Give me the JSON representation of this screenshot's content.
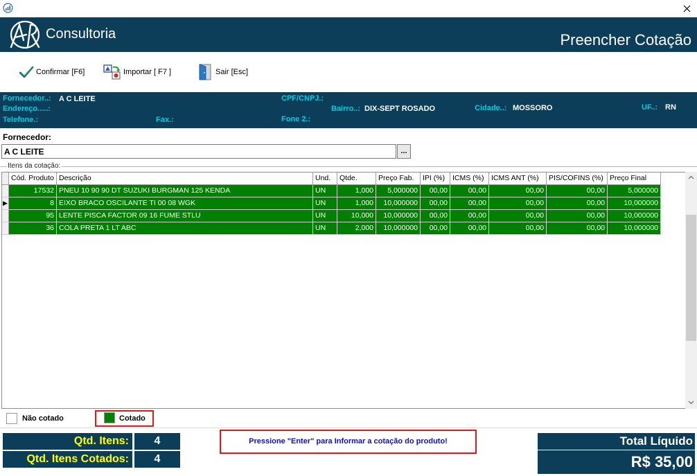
{
  "window": {
    "app_icon": "chart-icon",
    "close_icon": "close-icon"
  },
  "header": {
    "logo_text": "Consultoria",
    "title": "Preencher Cotação"
  },
  "toolbar": {
    "confirm_label": "Confirmar [F6]",
    "import_label": "Importar  [ F7 ]",
    "exit_label": "Sair  [Esc]"
  },
  "supplier_info": {
    "fornecedor_label": "Fornecedor..:",
    "fornecedor_value": "A C LEITE",
    "cpf_label": "CPF/CNPJ.:",
    "cpf_value": "",
    "endereco_label": "Endereço.....:",
    "endereco_value": "",
    "bairro_label": "Bairro..:",
    "bairro_value": "DIX-SEPT ROSADO",
    "cidade_label": "Cidade..:",
    "cidade_value": "MOSSORO",
    "uf_label": "UF..:",
    "uf_value": "RN",
    "telefone_label": "Telefone.:",
    "telefone_value": "",
    "fax_label": "Fax.:",
    "fax_value": "",
    "fone2_label": "Fone 2.:",
    "fone2_value": ""
  },
  "fornecedor_field": {
    "label": "Fornecedor:",
    "value": "A C LEITE",
    "lookup_button": "..."
  },
  "items": {
    "legend": "Itens da cotação:",
    "columns": [
      "Cód. Produto",
      "Descrição",
      "Und.",
      "Qtde.",
      "Preço Fab.",
      "IPI (%)",
      "ICMS (%)",
      "ICMS ANT (%)",
      "PIS/COFINS (%)",
      "Preço Final"
    ],
    "rows": [
      [
        "17532",
        "PNEU 10 90 90 DT  SUZUKI BURGMAN 125 KENDA",
        "UN",
        "1,000",
        "5,000000",
        "00,00",
        "00,00",
        "00,00",
        "00,00",
        "5,000000"
      ],
      [
        "8",
        "EIXO BRACO OSCILANTE TI 00 08 WGK",
        "UN",
        "1,000",
        "10,000000",
        "00,00",
        "00,00",
        "00,00",
        "00,00",
        "10,000000"
      ],
      [
        "95",
        "LENTE PISCA FACTOR 09 16 FUME STLU",
        "UN",
        "10,000",
        "10,000000",
        "00,00",
        "00,00",
        "00,00",
        "00,00",
        "10,000000"
      ],
      [
        "36",
        "COLA PRETA 1 LT ABC",
        "UN",
        "2,000",
        "10,000000",
        "00,00",
        "00,00",
        "00,00",
        "00,00",
        "10,000000"
      ]
    ],
    "current_row_marker": "▶"
  },
  "legend": {
    "not_quoted": "Não cotado",
    "quoted": "Cotado"
  },
  "summary": {
    "qtd_itens_label": "Qtd. Itens:",
    "qtd_itens_value": "4",
    "qtd_cotados_label": "Qtd. Itens Cotados:",
    "qtd_cotados_value": "4",
    "hint": "Pressione \"Enter\" para Informar a cotação do produto!",
    "total_label": "Total Líquido",
    "total_value": "R$ 35,00"
  },
  "colors": {
    "header_bg": "#0c3e5a",
    "quoted_green": "#018001",
    "info_label": "#00cbe0",
    "stat_label": "#ffff00",
    "hint_text": "#1010c8",
    "hint_border": "#e01818"
  }
}
